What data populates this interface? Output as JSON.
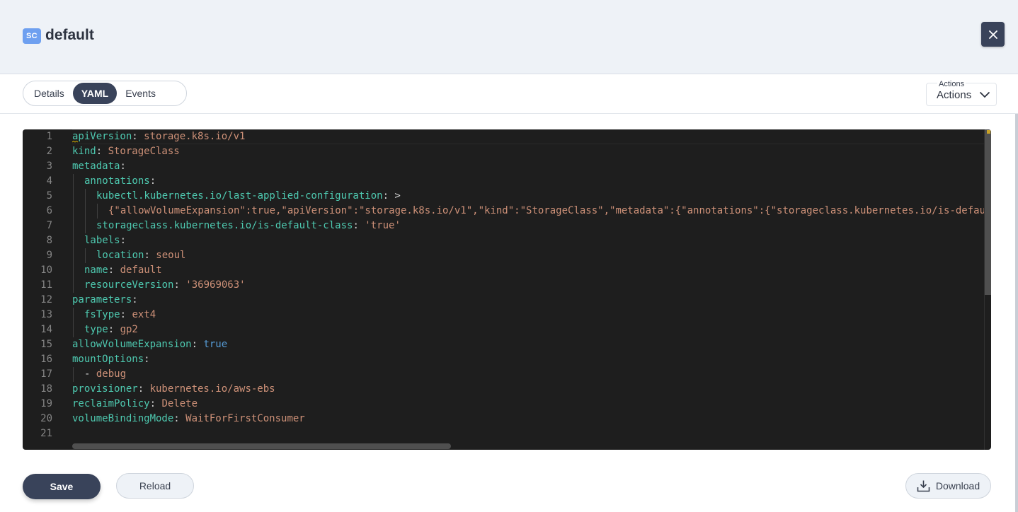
{
  "header": {
    "badge": "SC",
    "title": "default"
  },
  "tabs": [
    {
      "label": "Details",
      "active": false
    },
    {
      "label": "YAML",
      "active": true
    },
    {
      "label": "Events",
      "active": false
    }
  ],
  "actions": {
    "caption": "Actions",
    "label": "Actions"
  },
  "editor": {
    "lines": [
      {
        "n": "1",
        "indent": 0,
        "parts": [
          [
            "k",
            "apiVersion"
          ],
          [
            "p",
            ": "
          ],
          [
            "v",
            "storage.k8s.io/v1"
          ]
        ]
      },
      {
        "n": "2",
        "indent": 0,
        "parts": [
          [
            "k",
            "kind"
          ],
          [
            "p",
            ": "
          ],
          [
            "v",
            "StorageClass"
          ]
        ]
      },
      {
        "n": "3",
        "indent": 0,
        "parts": [
          [
            "k",
            "metadata"
          ],
          [
            "p",
            ":"
          ]
        ]
      },
      {
        "n": "4",
        "indent": 1,
        "parts": [
          [
            "k",
            "annotations"
          ],
          [
            "p",
            ":"
          ]
        ]
      },
      {
        "n": "5",
        "indent": 2,
        "parts": [
          [
            "k",
            "kubectl.kubernetes.io/last-applied-configuration"
          ],
          [
            "p",
            ": >"
          ]
        ]
      },
      {
        "n": "6",
        "indent": 3,
        "parts": [
          [
            "v",
            "{\"allowVolumeExpansion\":true,\"apiVersion\":\"storage.k8s.io/v1\",\"kind\":\"StorageClass\",\"metadata\":{\"annotations\":{\"storageclass.kubernetes.io/is-default-class\":\"true\"}}}"
          ]
        ]
      },
      {
        "n": "7",
        "indent": 2,
        "parts": [
          [
            "k",
            "storageclass.kubernetes.io/is-default-class"
          ],
          [
            "p",
            ": "
          ],
          [
            "v",
            "'true'"
          ]
        ]
      },
      {
        "n": "8",
        "indent": 1,
        "parts": [
          [
            "k",
            "labels"
          ],
          [
            "p",
            ":"
          ]
        ]
      },
      {
        "n": "9",
        "indent": 2,
        "parts": [
          [
            "k",
            "location"
          ],
          [
            "p",
            ": "
          ],
          [
            "v",
            "seoul"
          ]
        ]
      },
      {
        "n": "10",
        "indent": 1,
        "parts": [
          [
            "k",
            "name"
          ],
          [
            "p",
            ": "
          ],
          [
            "v",
            "default"
          ]
        ]
      },
      {
        "n": "11",
        "indent": 1,
        "parts": [
          [
            "k",
            "resourceVersion"
          ],
          [
            "p",
            ": "
          ],
          [
            "v",
            "'36969063'"
          ]
        ]
      },
      {
        "n": "12",
        "indent": 0,
        "parts": [
          [
            "k",
            "parameters"
          ],
          [
            "p",
            ":"
          ]
        ]
      },
      {
        "n": "13",
        "indent": 1,
        "parts": [
          [
            "k",
            "fsType"
          ],
          [
            "p",
            ": "
          ],
          [
            "v",
            "ext4"
          ]
        ]
      },
      {
        "n": "14",
        "indent": 1,
        "parts": [
          [
            "k",
            "type"
          ],
          [
            "p",
            ": "
          ],
          [
            "v",
            "gp2"
          ]
        ]
      },
      {
        "n": "15",
        "indent": 0,
        "parts": [
          [
            "k",
            "allowVolumeExpansion"
          ],
          [
            "p",
            ": "
          ],
          [
            "b",
            "true"
          ]
        ]
      },
      {
        "n": "16",
        "indent": 0,
        "parts": [
          [
            "k",
            "mountOptions"
          ],
          [
            "p",
            ":"
          ]
        ]
      },
      {
        "n": "17",
        "indent": 1,
        "parts": [
          [
            "p",
            "- "
          ],
          [
            "v",
            "debug"
          ]
        ]
      },
      {
        "n": "18",
        "indent": 0,
        "parts": [
          [
            "k",
            "provisioner"
          ],
          [
            "p",
            ": "
          ],
          [
            "v",
            "kubernetes.io/aws-ebs"
          ]
        ]
      },
      {
        "n": "19",
        "indent": 0,
        "parts": [
          [
            "k",
            "reclaimPolicy"
          ],
          [
            "p",
            ": "
          ],
          [
            "v",
            "Delete"
          ]
        ]
      },
      {
        "n": "20",
        "indent": 0,
        "parts": [
          [
            "k",
            "volumeBindingMode"
          ],
          [
            "p",
            ": "
          ],
          [
            "v",
            "WaitForFirstConsumer"
          ]
        ]
      },
      {
        "n": "21",
        "indent": 0,
        "parts": []
      }
    ]
  },
  "footer": {
    "save": "Save",
    "reload": "Reload",
    "download": "Download"
  },
  "colors": {
    "primary": "#39435a",
    "badge": "#6ea0f0",
    "key": "#4ec9b0",
    "string": "#ce9178",
    "boolean": "#569cd6"
  }
}
